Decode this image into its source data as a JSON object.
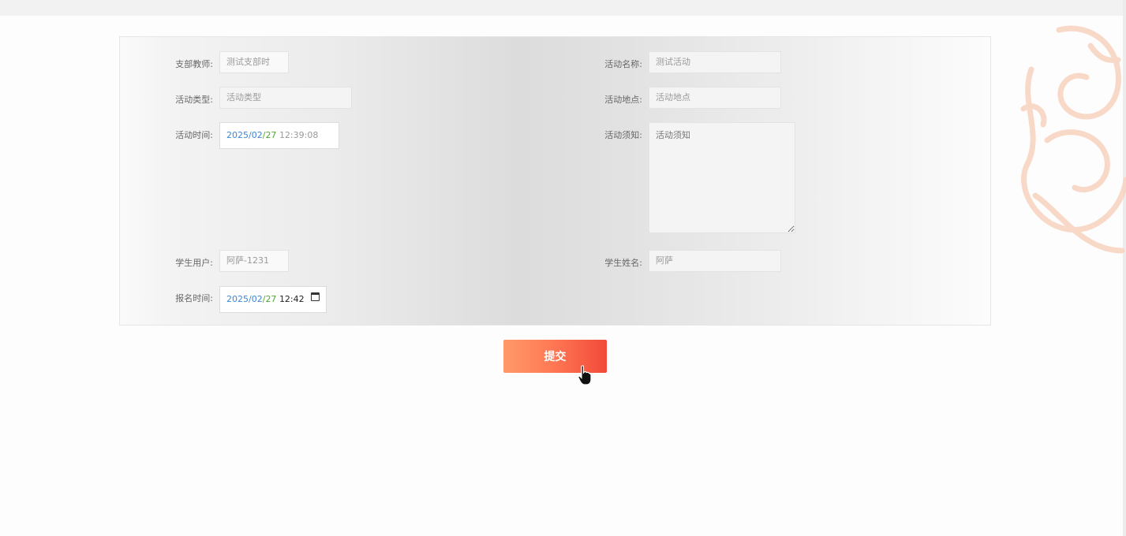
{
  "form": {
    "teacher": {
      "label": "支部教师:",
      "value": "测试支部时"
    },
    "activity_name": {
      "label": "活动名称:",
      "value": "测试活动"
    },
    "activity_type": {
      "label": "活动类型:",
      "placeholder": "活动类型"
    },
    "activity_location": {
      "label": "活动地点:",
      "placeholder": "活动地点"
    },
    "activity_time": {
      "label": "活动时间:",
      "year": "2025",
      "month": "02",
      "day": "27",
      "time": "12:39:08"
    },
    "activity_notice": {
      "label": "活动须知:",
      "placeholder": "活动须知"
    },
    "student_user": {
      "label": "学生用户:",
      "value": "阿萨-1231"
    },
    "student_name": {
      "label": "学生姓名:",
      "value": "阿萨"
    },
    "signup_time": {
      "label": "报名时间:",
      "year": "2025",
      "month": "02",
      "day": "27",
      "time": "12:42"
    }
  },
  "submit_label": "提交",
  "colors": {
    "button_start": "#ff9a6a",
    "button_end": "#f24a3a",
    "date_year": "#3b86d9",
    "date_day": "#4fa830"
  },
  "icons": {
    "calendar": "calendar-icon",
    "cursor": "hand-cursor-icon",
    "background": "dragon-watermark"
  }
}
